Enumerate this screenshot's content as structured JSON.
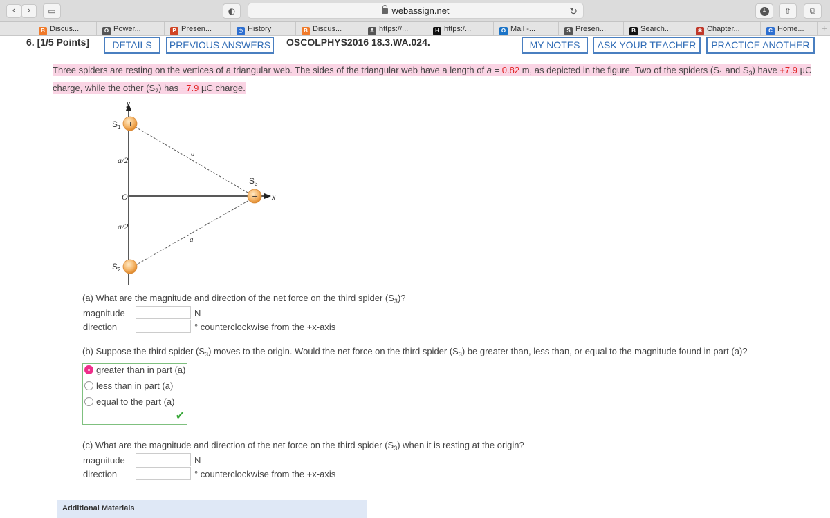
{
  "browser": {
    "url": "webassign.net",
    "bookmarks": [
      {
        "label": "Discus...",
        "icon": "b-icon",
        "color": "#f07a2a"
      },
      {
        "label": "Power...",
        "icon": "o-icon",
        "color": "#555555"
      },
      {
        "label": "Presen...",
        "icon": "p-icon",
        "color": "#d14424"
      },
      {
        "label": "History",
        "icon": "history-icon",
        "color": "#2d6fd1"
      },
      {
        "label": "Discus...",
        "icon": "b-icon",
        "color": "#f07a2a"
      },
      {
        "label": "https://...",
        "icon": "a-icon",
        "color": "#555555"
      },
      {
        "label": "https:/...",
        "icon": "h-icon",
        "color": "#111111"
      },
      {
        "label": "Mail -...",
        "icon": "outlook-icon",
        "color": "#1a73c7"
      },
      {
        "label": "Presen...",
        "icon": "s-icon",
        "color": "#555555"
      },
      {
        "label": "Search...",
        "icon": "b-icon",
        "color": "#111111"
      },
      {
        "label": "Chapter...",
        "icon": "chapter-icon",
        "color": "#c0392b"
      },
      {
        "label": "Home...",
        "icon": "c-icon",
        "color": "#2d6fd1"
      }
    ]
  },
  "question": {
    "number": "6.  [1/5 Points]",
    "details_btn": "DETAILS",
    "previous_btn": "PREVIOUS ANSWERS",
    "code": "OSCOLPHYS2016 18.3.WA.024.",
    "notes_btn": "MY NOTES",
    "teacher_btn": "ASK YOUR TEACHER",
    "practice_btn": "PRACTICE ANOTHER"
  },
  "problem": {
    "text1": "Three spiders are resting on the vertices of a triangular web. The sides of the triangular web have a length of ",
    "a_var": "a",
    "eq": " = ",
    "a_val": "0.82",
    "text2": " m, as depicted in the figure. Two of the spiders (S",
    "text3": " and S",
    "text4": ") have ",
    "q_pos": "+7.9",
    "text5": " µC",
    "text6": "charge, while the other (S",
    "text7": ") has ",
    "q_neg": "−7.9",
    "text8": " µC charge."
  },
  "figure": {
    "y_axis": "y",
    "x_axis": "x",
    "origin": "O",
    "s1": "S",
    "s2": "S",
    "s3": "S",
    "s1_sub": "1",
    "s2_sub": "2",
    "s3_sub": "3",
    "half_top": "a/2",
    "half_bottom": "a/2",
    "side_top": "a",
    "side_bottom": "a",
    "plus": "+",
    "minus": "−"
  },
  "part_a": {
    "question": "(a) What are the magnitude and direction of the net force on the third spider (S",
    "question_sub": "3",
    "question_end": ")?",
    "magnitude_label": "magnitude",
    "direction_label": "direction",
    "magnitude_unit": "N",
    "direction_unit": "° counterclockwise from the +x-axis"
  },
  "part_b": {
    "question1": "(b) Suppose the third spider (S",
    "question2": ") moves to the origin. Would the net force on the third spider (S",
    "question3": ") be greater than, less than, or equal to the magnitude found in part (a)?",
    "sub": "3",
    "options": [
      "greater than in part (a)",
      "less than in part (a)",
      "equal to the part (a)"
    ],
    "selected": "greater than in part (a)"
  },
  "part_c": {
    "question1": "(c) What are the magnitude and direction of the net force on the third spider (S",
    "question2": ") when it is resting at the origin?",
    "sub": "3",
    "magnitude_label": "magnitude",
    "direction_label": "direction",
    "magnitude_unit": "N",
    "direction_unit": "° counterclockwise from the +x-axis"
  },
  "additional_materials": "Additional Materials"
}
